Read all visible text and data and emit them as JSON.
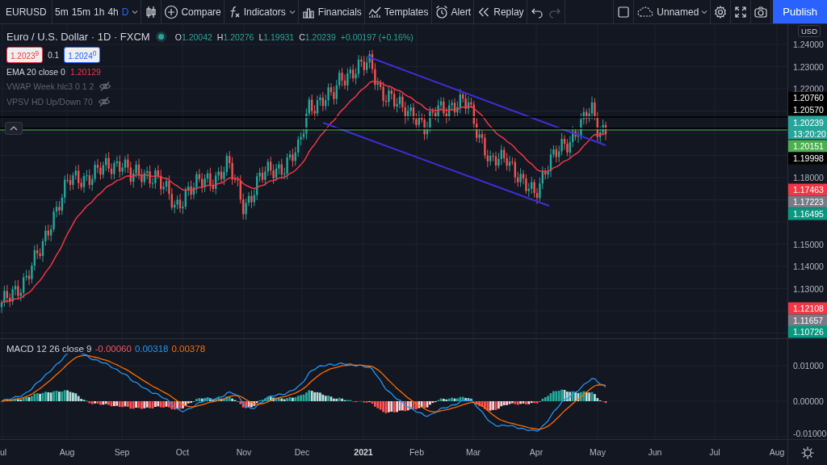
{
  "toolbar": {
    "symbol": "EURUSD",
    "intervals": [
      {
        "label": "5m",
        "selected": false
      },
      {
        "label": "15m",
        "selected": false
      },
      {
        "label": "1h",
        "selected": false
      },
      {
        "label": "4h",
        "selected": false
      },
      {
        "label": "D",
        "selected": true
      }
    ],
    "buttons": [
      {
        "kind": "compare",
        "label": "Compare"
      },
      {
        "kind": "indicators",
        "label": "Indicators"
      },
      {
        "kind": "financials",
        "label": "Financials"
      },
      {
        "kind": "templates",
        "label": "Templates"
      },
      {
        "kind": "alert",
        "label": "Alert"
      },
      {
        "kind": "replay",
        "label": "Replay"
      }
    ],
    "history": [
      {
        "kind": "undo",
        "disabled": false
      },
      {
        "kind": "redo",
        "disabled": true
      }
    ],
    "layout_name": "Unnamed",
    "publish": "Publish"
  },
  "legend": {
    "title": "Euro / U.S. Dollar · 1D · FXCM",
    "ohlc": [
      {
        "key": "O",
        "value": "1.20042"
      },
      {
        "key": "H",
        "value": "1.20276"
      },
      {
        "key": "L",
        "value": "1.19931"
      },
      {
        "key": "C",
        "value": "1.20239"
      }
    ],
    "change": "+0.00197 (+0.16%)",
    "bid": "1.2023$^{9}$",
    "spread": "0.1",
    "ask": "1.2024$^{0}$"
  },
  "studies": [
    {
      "name": "EMA 20 close 0",
      "value": "1.20129",
      "hidden": false
    },
    {
      "name": "VWAP Week hlc3 0 1 2",
      "hidden": true
    },
    {
      "name": "VPSV HD Up/Down 70",
      "hidden": true
    }
  ],
  "price_axis": {
    "currency": "USD",
    "ticks": [
      "1.24000",
      "1.23000",
      "1.22000",
      "1.18000",
      "1.15000",
      "1.14000",
      "1.13000"
    ],
    "badges": [
      {
        "text": "1.20760",
        "color": "#000000",
        "current": false
      },
      {
        "text": "1.20570",
        "color": "#000000",
        "current": false
      },
      {
        "text": "1.20239",
        "countdown": "13:20:20",
        "color": "#26a69a",
        "current": true
      },
      {
        "text": "1.20151",
        "color": "#4caf50",
        "current": false
      },
      {
        "text": "1.19998",
        "color": "#000000",
        "current": false
      },
      {
        "text": "1.17463",
        "color": "#f23645",
        "current": false
      },
      {
        "text": "1.17223",
        "color": "#787b86",
        "current": false
      },
      {
        "text": "1.16495",
        "color": "#089981",
        "current": false
      },
      {
        "text": "1.12108",
        "color": "#f23645",
        "current": false
      },
      {
        "text": "1.11657",
        "color": "#787b86",
        "current": false
      },
      {
        "text": "1.10726",
        "color": "#089981",
        "current": false
      }
    ]
  },
  "macd": {
    "name": "MACD 12 26 close 9",
    "values": [
      {
        "text": "-0.00060",
        "color": "#f7525f"
      },
      {
        "text": "0.00318",
        "color": "#2196f3"
      },
      {
        "text": "0.00378",
        "color": "#ff6d00"
      }
    ],
    "ticks": [
      "0.01000",
      "0.00000",
      "-0.01000"
    ]
  },
  "time_axis": {
    "labels": [
      {
        "text": "ul",
        "year": false
      },
      {
        "text": "Aug",
        "year": false
      },
      {
        "text": "Sep",
        "year": false
      },
      {
        "text": "Oct",
        "year": false
      },
      {
        "text": "Nov",
        "year": false
      },
      {
        "text": "Dec",
        "year": false
      },
      {
        "text": "2021",
        "year": true
      },
      {
        "text": "Feb",
        "year": false
      },
      {
        "text": "Mar",
        "year": false
      },
      {
        "text": "Apr",
        "year": false
      },
      {
        "text": "May",
        "year": false
      },
      {
        "text": "Jun",
        "year": false
      },
      {
        "text": "Jul",
        "year": false
      },
      {
        "text": "Aug",
        "year": false
      }
    ]
  }
}
